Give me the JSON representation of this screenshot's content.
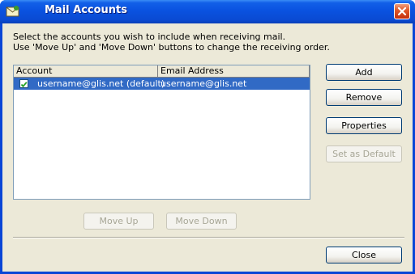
{
  "window": {
    "title": "Mail Accounts"
  },
  "intro": {
    "line1": "Select the accounts you wish to include when receiving mail.",
    "line2": "Use 'Move Up' and 'Move Down' buttons to change the receiving order."
  },
  "table": {
    "columns": [
      "Account",
      "Email Address"
    ],
    "rows": [
      {
        "checked": true,
        "account": "username@glis.net (default)",
        "email": "username@glis.net",
        "selected": true
      }
    ]
  },
  "buttons": {
    "add": "Add",
    "remove": "Remove",
    "properties": "Properties",
    "set_default": "Set as Default",
    "move_up": "Move Up",
    "move_down": "Move Down",
    "close": "Close"
  },
  "colors": {
    "title_bar": "#0a52e0",
    "selection": "#316ac5",
    "dialog_bg": "#ece9d8"
  }
}
